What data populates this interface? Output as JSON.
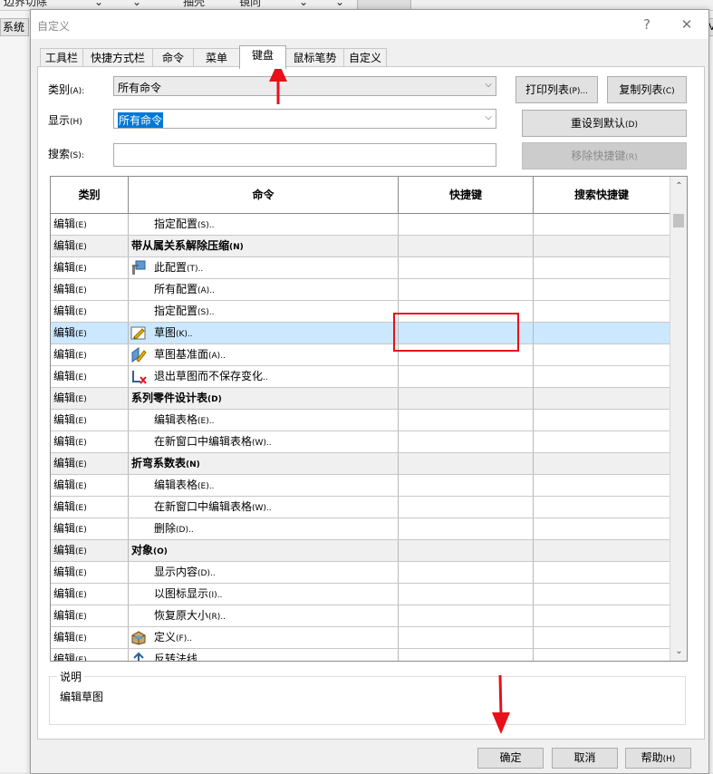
{
  "background_app": {
    "toolbar_items": [
      "边界切除",
      "抽壳",
      "镜向"
    ],
    "left_tab": "系统",
    "right_tab": "V"
  },
  "dialog": {
    "title": "自定义",
    "help_button": "?",
    "close_button": "✕"
  },
  "tabs": [
    {
      "label": "工具栏",
      "active": false
    },
    {
      "label": "快捷方式栏",
      "active": false
    },
    {
      "label": "命令",
      "active": false
    },
    {
      "label": "菜单",
      "active": false
    },
    {
      "label": "键盘",
      "active": true
    },
    {
      "label": "鼠标笔势",
      "active": false
    },
    {
      "label": "自定义",
      "active": false
    }
  ],
  "form": {
    "category_label": "类别",
    "category_key": "(A):",
    "category_value": "所有命令",
    "show_label": "显示",
    "show_key": "(H)",
    "show_value": "所有命令",
    "search_label": "搜索",
    "search_key": "(S):",
    "search_value": "",
    "print_list_button": "打印列表",
    "print_list_key": "(P)...",
    "copy_list_button": "复制列表",
    "copy_list_key": "(C)",
    "reset_button": "重设到默认",
    "reset_key": "(D)",
    "remove_shortcut_button": "移除快捷键",
    "remove_shortcut_key": "(R)"
  },
  "table": {
    "headers": {
      "category": "类别",
      "command": "命令",
      "shortcut": "快捷键",
      "search_shortcut": "搜索快捷键"
    },
    "rows": [
      {
        "category": "编辑",
        "category_key": "(E)",
        "command": "指定配置",
        "command_key": "(S)..",
        "icon": "",
        "group": false,
        "selected": false
      },
      {
        "category": "编辑",
        "category_key": "(E)",
        "command": "带从属关系解除压缩",
        "command_key": "(N)",
        "icon": "",
        "group": true,
        "selected": false
      },
      {
        "category": "编辑",
        "category_key": "(E)",
        "command": "此配置",
        "command_key": "(T)..",
        "icon": "config-icon",
        "group": false,
        "selected": false
      },
      {
        "category": "编辑",
        "category_key": "(E)",
        "command": "所有配置",
        "command_key": "(A)..",
        "icon": "",
        "group": false,
        "selected": false
      },
      {
        "category": "编辑",
        "category_key": "(E)",
        "command": "指定配置",
        "command_key": "(S)..",
        "icon": "",
        "group": false,
        "selected": false
      },
      {
        "category": "编辑",
        "category_key": "(E)",
        "command": "草图",
        "command_key": "(K)..",
        "icon": "sketch-icon",
        "group": false,
        "selected": true
      },
      {
        "category": "编辑",
        "category_key": "(E)",
        "command": "草图基准面",
        "command_key": "(A)..",
        "icon": "sketch-plane-icon",
        "group": false,
        "selected": false
      },
      {
        "category": "编辑",
        "category_key": "(E)",
        "command": "退出草图而不保存变化",
        "command_key": "..",
        "icon": "exit-sketch-icon",
        "group": false,
        "selected": false
      },
      {
        "category": "编辑",
        "category_key": "(E)",
        "command": "系列零件设计表",
        "command_key": "(D)",
        "icon": "",
        "group": true,
        "selected": false
      },
      {
        "category": "编辑",
        "category_key": "(E)",
        "command": "编辑表格",
        "command_key": "(E)..",
        "icon": "",
        "group": false,
        "selected": false
      },
      {
        "category": "编辑",
        "category_key": "(E)",
        "command": "在新窗口中编辑表格",
        "command_key": "(W)..",
        "icon": "",
        "group": false,
        "selected": false
      },
      {
        "category": "编辑",
        "category_key": "(E)",
        "command": "折弯系数表",
        "command_key": "(N)",
        "icon": "",
        "group": true,
        "selected": false
      },
      {
        "category": "编辑",
        "category_key": "(E)",
        "command": "编辑表格",
        "command_key": "(E)..",
        "icon": "",
        "group": false,
        "selected": false
      },
      {
        "category": "编辑",
        "category_key": "(E)",
        "command": "在新窗口中编辑表格",
        "command_key": "(W)..",
        "icon": "",
        "group": false,
        "selected": false
      },
      {
        "category": "编辑",
        "category_key": "(E)",
        "command": "删除",
        "command_key": "(D)..",
        "icon": "",
        "group": false,
        "selected": false
      },
      {
        "category": "编辑",
        "category_key": "(E)",
        "command": "对象",
        "command_key": "(O)",
        "icon": "",
        "group": true,
        "selected": false
      },
      {
        "category": "编辑",
        "category_key": "(E)",
        "command": "显示内容",
        "command_key": "(D)..",
        "icon": "",
        "group": false,
        "selected": false
      },
      {
        "category": "编辑",
        "category_key": "(E)",
        "command": "以图标显示",
        "command_key": "(I)..",
        "icon": "",
        "group": false,
        "selected": false
      },
      {
        "category": "编辑",
        "category_key": "(E)",
        "command": "恢复原大小",
        "command_key": "(R)..",
        "icon": "",
        "group": false,
        "selected": false
      },
      {
        "category": "编辑",
        "category_key": "(E)",
        "command": "定义",
        "command_key": "(F)..",
        "icon": "define-icon",
        "group": false,
        "selected": false
      },
      {
        "category": "编辑",
        "category_key": "(E)",
        "command": "反转法线",
        "command_key": "",
        "icon": "flip-normal-icon",
        "group": false,
        "selected": false
      }
    ]
  },
  "description": {
    "title": "说明",
    "text": "编辑草图"
  },
  "footer": {
    "ok_button": "确定",
    "cancel_button": "取消",
    "help_button": "帮助",
    "help_key": "(H)"
  },
  "colors": {
    "selected_row": "#cce8ff",
    "group_row": "#f0f0f0",
    "annotation_red": "#e8101a"
  }
}
